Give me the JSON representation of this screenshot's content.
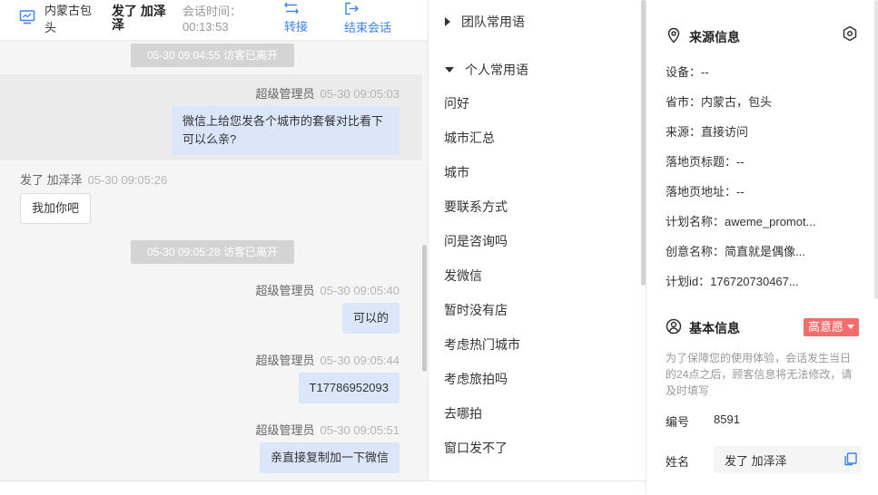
{
  "header": {
    "location": "内蒙古包头",
    "visitor_name": "发了 加泽泽",
    "session_label": "会话时间：",
    "session_time": "00:13:53",
    "transfer_label": "转接",
    "end_label": "结束会话",
    "accent_color": "#3b82f6"
  },
  "messages": {
    "notice_1": "05-30 09:04:55 访客已离开",
    "msg1_sender": "超级管理员",
    "msg1_time": "05-30 09:05:03",
    "msg1_line1": "微信上给您发各个城市的套餐对比看下",
    "msg1_line2": "可以么亲?",
    "msg2_sender": "发了 加泽泽",
    "msg2_time": "05-30 09:05:26",
    "msg2_text": "我加你吧",
    "notice_2": "05-30 09:05:28 访客已离开",
    "msg3_sender": "超级管理员",
    "msg3_time": "05-30 09:05:40",
    "msg3_text": "可以的",
    "msg4_sender": "超级管理员",
    "msg4_time": "05-30 09:05:44",
    "msg4_text": "T17786952093",
    "msg5_sender": "超级管理员",
    "msg5_time": "05-30 09:05:51",
    "msg5_text": "亲直接复制加一下微信"
  },
  "phrases": {
    "team_title": "团队常用语",
    "personal_title": "个人常用语",
    "items": [
      "问好",
      "城市汇总",
      "城市",
      "要联系方式",
      "问是咨询吗",
      "发微信",
      "暂时没有店",
      "考虑热门城市",
      "考虑旅拍吗",
      "去哪拍",
      "窗口发不了"
    ]
  },
  "info": {
    "source_title": "来源信息",
    "device": "设备：--",
    "province": "省市：内蒙古，包头",
    "source": "来源：直接访问",
    "landing_title": "落地页标题：--",
    "landing_url": "落地页地址：--",
    "plan_name": "计划名称：aweme_promot...",
    "creative_name": "创意名称：简直就是偶像...",
    "plan_id": "计划id：176720730467...",
    "basic_title": "基本信息",
    "intent_label": "高意愿",
    "intent_color": "#f56c6c",
    "notice": "为了保障您的使用体验，会话发生当日的24点之后，顾客信息将无法修改，请及时填写",
    "id_label": "编号",
    "id_value": "8591",
    "name_label": "姓名",
    "name_value": "发了 加泽泽"
  }
}
